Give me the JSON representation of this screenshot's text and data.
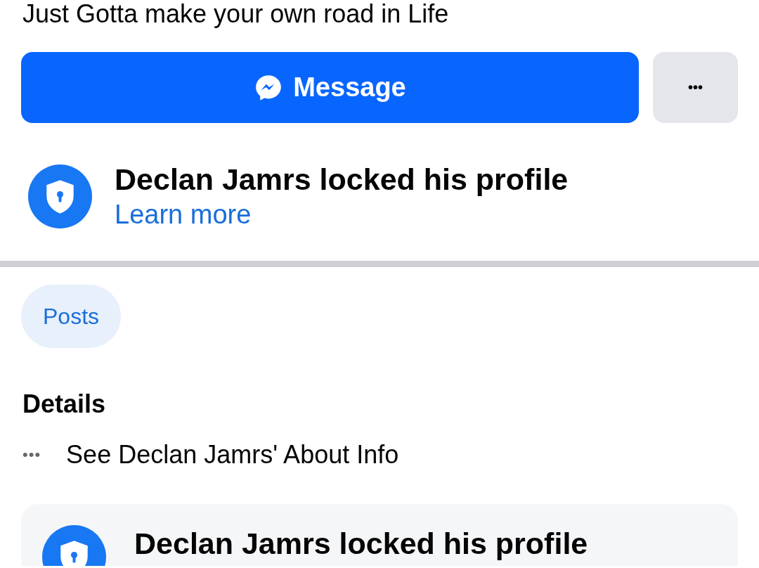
{
  "bio": "Just Gotta make your own road in Life",
  "actions": {
    "message_button": "Message",
    "more_button": "•••"
  },
  "lock_notice": {
    "title": "Declan Jamrs locked his profile",
    "link": "Learn more"
  },
  "tabs": [
    {
      "label": "Posts",
      "selected": true
    }
  ],
  "details": {
    "heading": "Details",
    "items": [
      {
        "icon": "•••",
        "text": "See Declan Jamrs' About Info"
      }
    ]
  },
  "post_card": {
    "title": "Declan Jamrs locked his profile"
  }
}
